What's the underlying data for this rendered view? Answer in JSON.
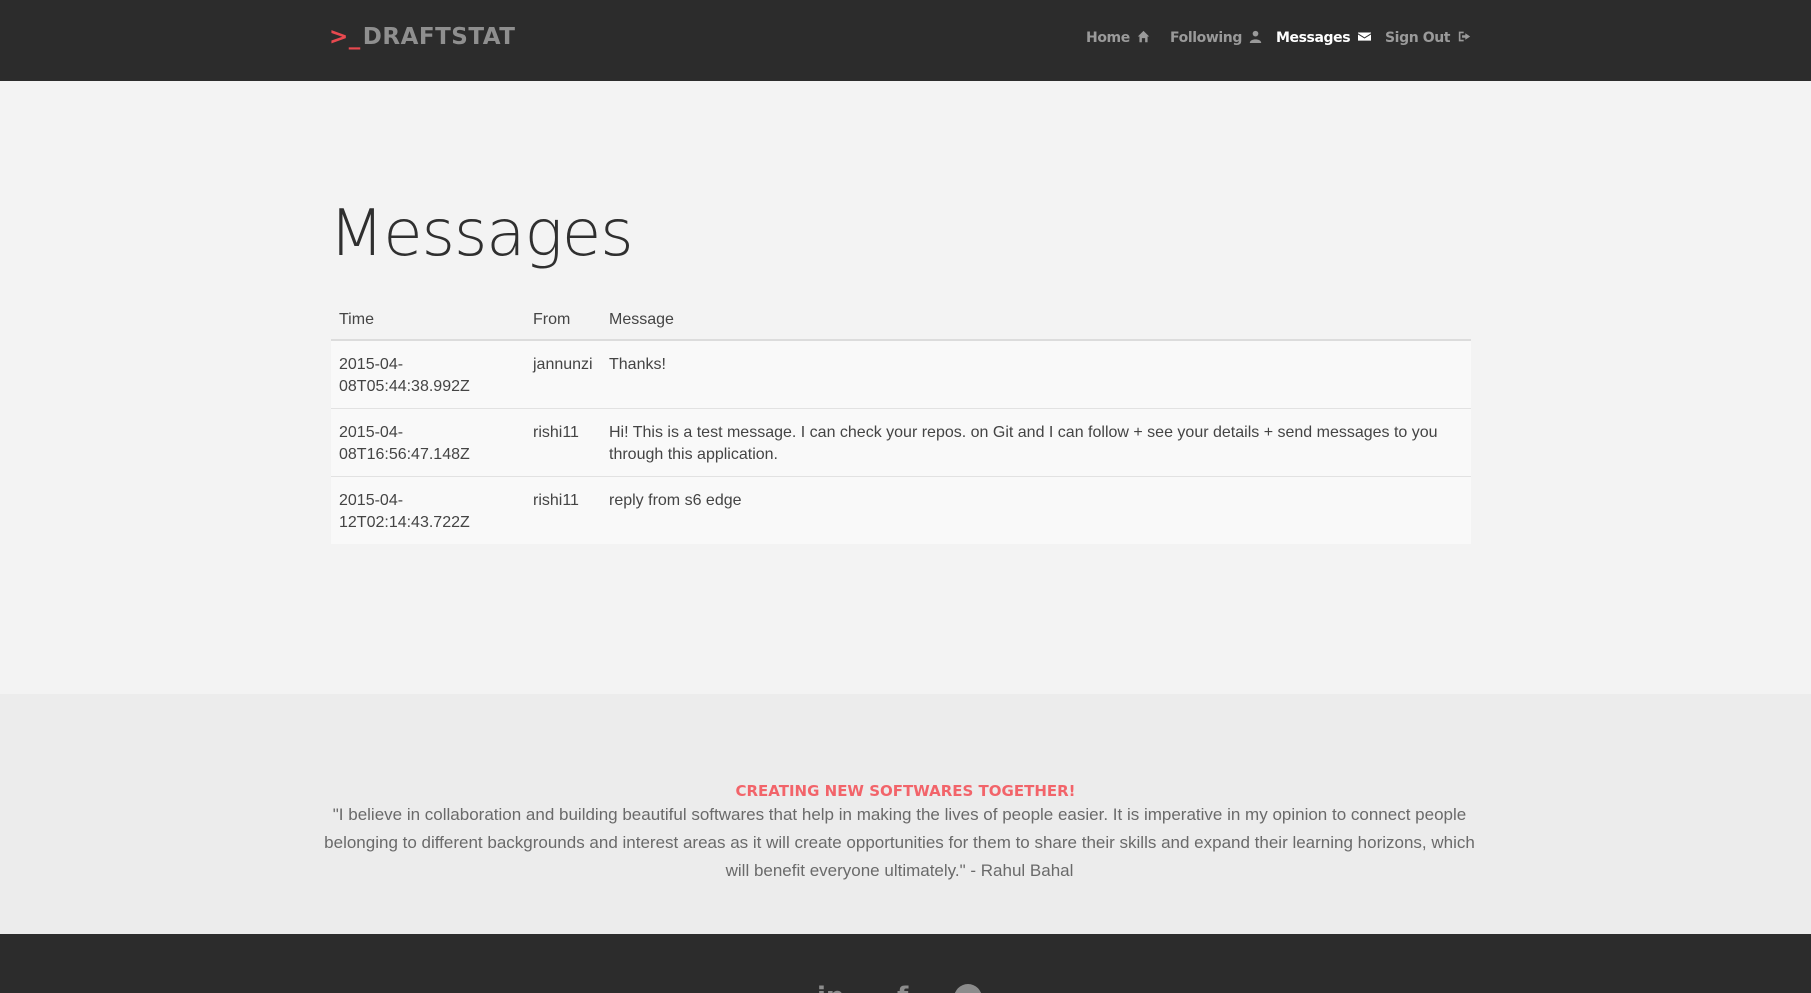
{
  "brand": {
    "prompt": ">_",
    "name": "DRAFTSTAT"
  },
  "nav": {
    "items": [
      {
        "label": "Home",
        "icon": "home-icon"
      },
      {
        "label": "Following",
        "icon": "user-icon"
      },
      {
        "label": "Messages",
        "icon": "envelope-icon",
        "active": true
      },
      {
        "label": "Sign Out",
        "icon": "sign-out-icon"
      }
    ]
  },
  "page": {
    "title": "Messages"
  },
  "table": {
    "headers": [
      "Time",
      "From",
      "Message"
    ],
    "rows": [
      {
        "time": "2015-04-08T05:44:38.992Z",
        "from": "jannunzi",
        "message": "Thanks!"
      },
      {
        "time": "2015-04-08T16:56:47.148Z",
        "from": "rishi11",
        "message": "Hi! This is a test message. I can check your repos. on Git and I can follow + see your details + send messages to you through this application."
      },
      {
        "time": "2015-04-12T02:14:43.722Z",
        "from": "rishi11",
        "message": "reply from s6 edge"
      }
    ]
  },
  "footer": {
    "heading": "CREATING NEW SOFTWARES TOGETHER!",
    "quote": "\"I believe in collaboration and building beautiful softwares that help in making the lives of people easier. It is imperative in my opinion to connect people belonging to different backgrounds and interest areas as it will create opportunities for them to share their skills and expand their learning horizons, which will benefit everyone ultimately.\" - Rahul Bahal"
  },
  "social": {
    "linkedin": "in",
    "facebook": "f",
    "icons": [
      "linkedin-icon",
      "facebook-icon",
      "github-icon"
    ]
  },
  "colors": {
    "navbar": "#2c2c2c",
    "accent": "#e8494f",
    "footer_heading": "#f2646a",
    "body_bg": "#f3f3f3"
  }
}
